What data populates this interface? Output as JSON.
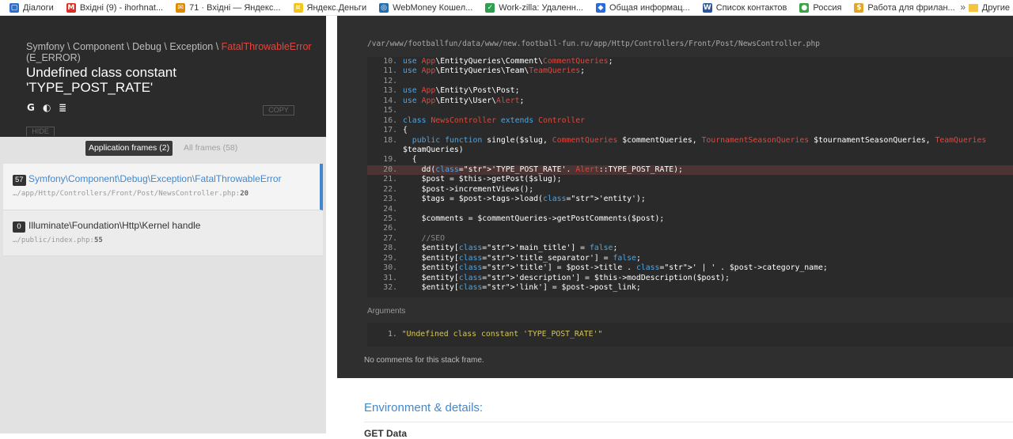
{
  "bookmarks": [
    {
      "label": "Діалоги",
      "icon": "chat-icon",
      "color": "#2d6fcb"
    },
    {
      "label": "Вхідні (9) - ihorhnat...",
      "icon": "gmail-icon",
      "color": "#d93025"
    },
    {
      "label": "71 · Вхідні — Яндекс...",
      "icon": "mail-icon",
      "color": "#e08a00"
    },
    {
      "label": "Яндекс.Деньги",
      "icon": "wallet-icon",
      "color": "#f5c518"
    },
    {
      "label": "WebMoney Кошел...",
      "icon": "webmoney-icon",
      "color": "#1f6fb2"
    },
    {
      "label": "Work-zilla: Удаленн...",
      "icon": "check-icon",
      "color": "#2e9e4f"
    },
    {
      "label": "Общая информац...",
      "icon": "shield-icon",
      "color": "#2a6ad9"
    },
    {
      "label": "Список контактов",
      "icon": "word-icon",
      "color": "#2b579a"
    },
    {
      "label": "Россия",
      "icon": "ball-icon",
      "color": "#3aa347"
    },
    {
      "label": "Работа для фрилан...",
      "icon": "coin-icon",
      "color": "#e0a52a"
    }
  ],
  "bookmarks_more": "»",
  "bookmarks_other": "Другие",
  "exception": {
    "namespace": "Symfony \\ Component \\ Debug \\ Exception \\ ",
    "class": "FatalThrowableError",
    "code": "(E_ERROR)",
    "message": "Undefined class constant 'TYPE_POST_RATE'",
    "copy_label": "COPY",
    "hide_label": "HIDE"
  },
  "frame_tabs": {
    "application": "Application frames (2)",
    "all": "All frames (58)"
  },
  "frames": [
    {
      "index": "57",
      "class": "Symfony\\Component\\Debug\\Exception\\FatalThrowableError",
      "file": "…/app/Http/Controllers/Front/Post/NewsController.php",
      "line": "20"
    },
    {
      "index": "0",
      "class": "Illuminate\\Foundation\\Http\\Kernel handle",
      "file": "…/public/index.php",
      "line": "55"
    }
  ],
  "code": {
    "file_path": "/var/www/footballfun/data/www/new.football-fun.ru/app/Http/Controllers/Front/Post/NewsController.php",
    "highlight_line": "20",
    "lines": [
      {
        "n": "10.",
        "text": "use App\\EntityQueries\\Comment\\CommentQueries;"
      },
      {
        "n": "11.",
        "text": "use App\\EntityQueries\\Team\\TeamQueries;"
      },
      {
        "n": "12.",
        "text": ""
      },
      {
        "n": "13.",
        "text": "use App\\Entity\\Post\\Post;"
      },
      {
        "n": "14.",
        "text": "use App\\Entity\\User\\Alert;"
      },
      {
        "n": "15.",
        "text": ""
      },
      {
        "n": "16.",
        "text": "class NewsController extends Controller"
      },
      {
        "n": "17.",
        "text": "{"
      },
      {
        "n": "18.",
        "text": "  public function single($slug, CommentQueries $commentQueries, TournamentSeasonQueries $tournamentSeasonQueries, TeamQueries"
      },
      {
        "n": "",
        "text": "$teamQueries)"
      },
      {
        "n": "19.",
        "text": "  {"
      },
      {
        "n": "20.",
        "text": "    dd('TYPE_POST_RATE'. Alert::TYPE_POST_RATE);"
      },
      {
        "n": "21.",
        "text": "    $post = $this->getPost($slug);"
      },
      {
        "n": "22.",
        "text": "    $post->incrementViews();"
      },
      {
        "n": "23.",
        "text": "    $tags = $post->tags->load('entity');"
      },
      {
        "n": "24.",
        "text": ""
      },
      {
        "n": "25.",
        "text": "    $comments = $commentQueries->getPostComments($post);"
      },
      {
        "n": "26.",
        "text": ""
      },
      {
        "n": "27.",
        "text": "    //SEO"
      },
      {
        "n": "28.",
        "text": "    $entity['main_title'] = false;"
      },
      {
        "n": "29.",
        "text": "    $entity['title_separator'] = false;"
      },
      {
        "n": "30.",
        "text": "    $entity['title'] = $post->title . ' | ' . $post->category_name;"
      },
      {
        "n": "31.",
        "text": "    $entity['description'] = $this->modDescription($post);"
      },
      {
        "n": "32.",
        "text": "    $entity['link'] = $post->post_link;"
      }
    ]
  },
  "arguments": {
    "label": "Arguments",
    "items": [
      {
        "num": "1.",
        "value": "\"Undefined class constant 'TYPE_POST_RATE'\""
      }
    ]
  },
  "no_comments": "No comments for this stack frame.",
  "environment": {
    "title": "Environment & details:",
    "get_data": "GET Data"
  }
}
